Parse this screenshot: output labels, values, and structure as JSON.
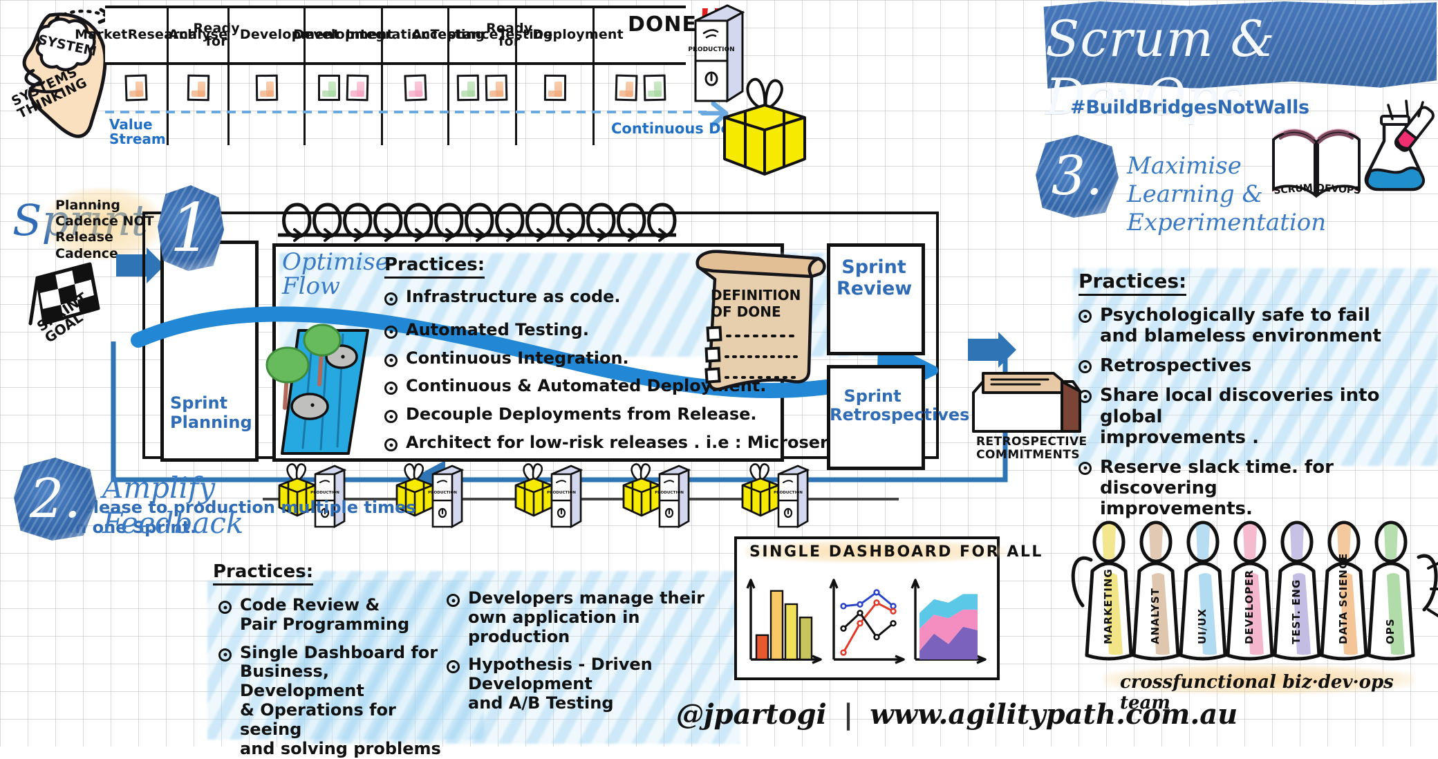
{
  "board": {
    "columns": [
      {
        "label": "Market\nResearch",
        "cards": [
          "o"
        ]
      },
      {
        "label": "Analyse",
        "cards": [
          "o"
        ]
      },
      {
        "label": "Ready for\nDevelopment",
        "cards": [
          "o"
        ]
      },
      {
        "label": "Development",
        "cards": [
          "g",
          "p"
        ]
      },
      {
        "label": "Integration\nTesting",
        "cards": [
          "p"
        ]
      },
      {
        "label": "Acceptance\nTesting",
        "cards": [
          "g",
          "o"
        ]
      },
      {
        "label": "Ready for\nDeployment",
        "cards": [
          "o"
        ]
      },
      {
        "label": "DONE",
        "cards": [
          "o",
          "g"
        ]
      }
    ],
    "done_label": "DONE",
    "done_bangs": "!!",
    "value_stream_label": "Value\nStream",
    "continuous_delivery_label": "Continuous  Delivery"
  },
  "systems_thinking": {
    "brain_label": "SYSTEM",
    "caption": "SYSTEMS\nTHINKING"
  },
  "banner": {
    "title": "Scrum & DevOps",
    "hashtag": "#BuildBridgesNotWalls"
  },
  "principle_one": {
    "number": "1",
    "heading": "Optimise\nFlow",
    "planning_card_label": "Sprint\nPlanning",
    "practices_heading": "Practices:",
    "practices": [
      "Infrastructure as code.",
      "Automated  Testing.",
      "Continuous   Integration.",
      "Continuous & Automated  Deployment.",
      "Decouple  Deployments from Release.",
      "Architect for low-risk releases . i.e : Microservice"
    ],
    "definition_of_done_title": "DEFINITION\nOF  DONE",
    "sprint_review_label": "Sprint\nReview",
    "sprint_retrospectives_label": "Sprint\nRetrospectives",
    "release_note": "Release  to production  multiple  times\nin one  Sprint.",
    "retrospective_commitments_label": "RETROSPECTIVE\nCOMMITMENTS"
  },
  "principle_two": {
    "number": "2.",
    "heading": "Amplify\nFeedback",
    "practices_heading": "Practices:",
    "practices_left": [
      "Code  Review &\nPair Programming",
      "Single Dashboard for\nBusiness, Development\n& Operations for seeing\nand solving problems"
    ],
    "practices_right": [
      "Developers manage  their\nown application in production",
      "Hypothesis - Driven  Development\nand  A/B Testing"
    ]
  },
  "principle_three": {
    "number": "3.",
    "heading": "Maximise\nLearning &\nExperimentation",
    "practices_heading": "Practices:",
    "practices": [
      "Psychologically  safe to fail\nand blameless environment",
      "Retrospectives",
      "Share  local discoveries into global\nimprovements .",
      "Reserve slack time. for discovering\nimprovements."
    ],
    "book_left_label": "SCRUM",
    "book_right_label": "DEVOPS"
  },
  "sprint": {
    "word": "Sprint",
    "planning_note": "Planning\nCadence  NOT\nRelease\nCadence",
    "goal_flag_label": "SPRINT\nGOAL"
  },
  "dashboard": {
    "title": "SINGLE  DASHBOARD  FOR  ALL"
  },
  "chart_data": [
    {
      "type": "bar",
      "title": "SINGLE DASHBOARD FOR ALL - bar panel",
      "categories": [
        "1",
        "2",
        "3",
        "4"
      ],
      "values": [
        22,
        62,
        50,
        38
      ],
      "colors": [
        "#e8592f",
        "#f8c766",
        "#f2e05a",
        "#c8c55e"
      ],
      "xlabel": "",
      "ylabel": "",
      "ylim": [
        0,
        70
      ],
      "grid": false,
      "legend": "none"
    },
    {
      "type": "line",
      "title": "SINGLE DASHBOARD FOR ALL - line panel",
      "x": [
        1,
        2,
        3,
        4
      ],
      "series": [
        {
          "name": "blue",
          "values": [
            62,
            64,
            78,
            62
          ],
          "color": "#2b45c9"
        },
        {
          "name": "red",
          "values": [
            8,
            42,
            66,
            56
          ],
          "color": "#e03b2a"
        },
        {
          "name": "black",
          "values": [
            36,
            54,
            26,
            42
          ],
          "color": "#111111"
        }
      ],
      "xlabel": "",
      "ylabel": "",
      "ylim": [
        0,
        90
      ],
      "grid": false,
      "legend": "none"
    },
    {
      "type": "area",
      "title": "SINGLE DASHBOARD FOR ALL - stacked area panel",
      "x": [
        1,
        2,
        3,
        4,
        5
      ],
      "series": [
        {
          "name": "purple",
          "values": [
            10,
            30,
            18,
            38,
            34
          ],
          "color": "#7b62bd"
        },
        {
          "name": "pink",
          "values": [
            26,
            22,
            30,
            20,
            24
          ],
          "color": "#f58ec0"
        },
        {
          "name": "cyan",
          "values": [
            18,
            18,
            18,
            18,
            18
          ],
          "color": "#5bc8e8"
        }
      ],
      "stacked": true,
      "xlabel": "",
      "ylabel": "",
      "ylim": [
        0,
        90
      ],
      "grid": false,
      "legend": "none"
    }
  ],
  "team": {
    "roles": [
      {
        "label": "MARKETING",
        "color": "#f0e27a"
      },
      {
        "label": "ANALYST",
        "color": "#dcc0a6"
      },
      {
        "label": "UI/UX",
        "color": "#a9d7ee"
      },
      {
        "label": "DEVELOPER",
        "color": "#f3aec6"
      },
      {
        "label": "TEST. ENG",
        "color": "#bdb6e0"
      },
      {
        "label": "DATA SCIENCE",
        "color": "#f2bf8c"
      },
      {
        "label": "OPS",
        "color": "#a9d8a0"
      }
    ],
    "caption": "crossfunctional  biz·dev·ops  team"
  },
  "production_server_label": "PRODUCTION",
  "footer": {
    "handle": "@jpartogi",
    "separator": "|",
    "site": "www.agilitypath.com.au"
  },
  "colors": {
    "brand_blue": "#2f6cb5",
    "ink": "#111111",
    "sticky_orange": "#efa472",
    "sticky_green": "#a4d69d",
    "sticky_pink": "#f49cbd",
    "gift_yellow": "#f5ea00",
    "wash_blue": "#a4d6f2",
    "wash_yellow": "#f7ce7e"
  }
}
